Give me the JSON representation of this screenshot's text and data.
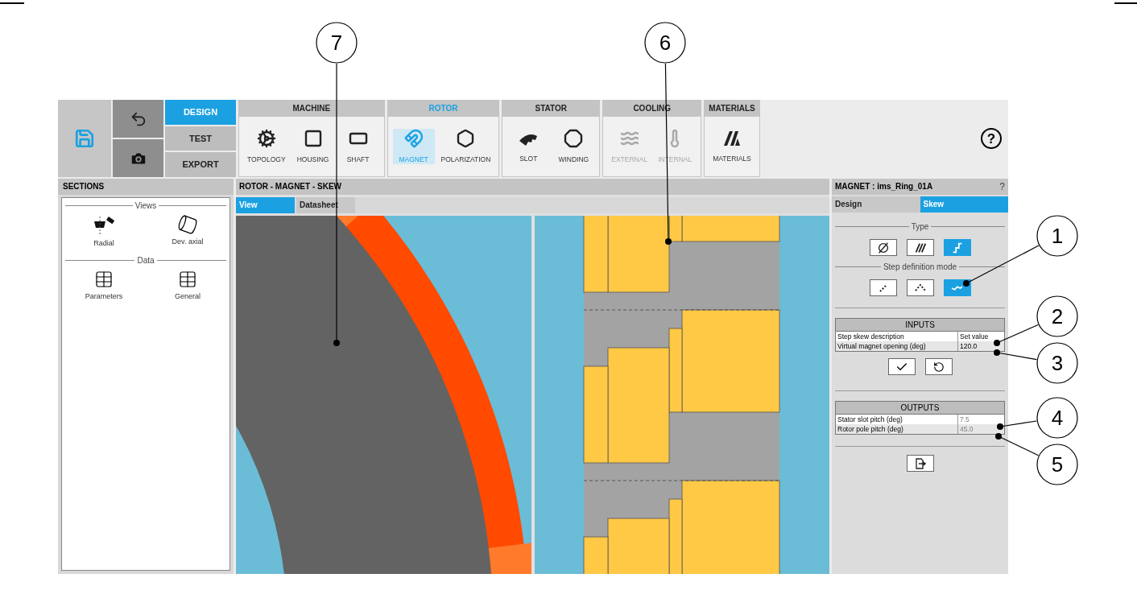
{
  "toolbar": {
    "modes": [
      {
        "label": "DESIGN",
        "selected": true
      },
      {
        "label": "TEST",
        "selected": false
      },
      {
        "label": "EXPORT",
        "selected": false
      }
    ],
    "groups": [
      {
        "title": "MACHINE",
        "selected": false,
        "tools": [
          {
            "label": "TOPOLOGY",
            "selected": false,
            "disabled": false
          },
          {
            "label": "HOUSING",
            "selected": false,
            "disabled": false
          },
          {
            "label": "SHAFT",
            "selected": false,
            "disabled": false
          }
        ]
      },
      {
        "title": "ROTOR",
        "selected": true,
        "tools": [
          {
            "label": "MAGNET",
            "selected": true,
            "disabled": false
          },
          {
            "label": "POLARIZATION",
            "selected": false,
            "disabled": false
          }
        ]
      },
      {
        "title": "STATOR",
        "selected": false,
        "tools": [
          {
            "label": "SLOT",
            "selected": false,
            "disabled": false
          },
          {
            "label": "WINDING",
            "selected": false,
            "disabled": false
          }
        ]
      },
      {
        "title": "COOLING",
        "selected": false,
        "tools": [
          {
            "label": "EXTERNAL",
            "selected": false,
            "disabled": true
          },
          {
            "label": "INTERNAL",
            "selected": false,
            "disabled": true
          }
        ]
      },
      {
        "title": "MATERIALS",
        "selected": false,
        "tools": [
          {
            "label": "MATERIALS",
            "selected": false,
            "disabled": false
          }
        ]
      }
    ]
  },
  "sections": {
    "title": "SECTIONS",
    "groups": [
      {
        "title": "Views",
        "items": [
          {
            "label": "Radial"
          },
          {
            "label": "Dev. axial"
          }
        ]
      },
      {
        "title": "Data",
        "items": [
          {
            "label": "Parameters"
          },
          {
            "label": "General"
          }
        ]
      }
    ]
  },
  "view": {
    "title": "ROTOR - MAGNET - SKEW",
    "tabs": [
      {
        "label": "View",
        "selected": true
      },
      {
        "label": "Datasheet",
        "selected": false
      }
    ]
  },
  "properties": {
    "title": "MAGNET : ims_Ring_01A",
    "help": "?",
    "tabs": [
      {
        "label": "Design",
        "selected": false
      },
      {
        "label": "Skew",
        "selected": true
      }
    ],
    "type": {
      "title": "Type",
      "options": [
        {
          "selected": false
        },
        {
          "selected": false
        },
        {
          "selected": true
        }
      ]
    },
    "step_mode": {
      "title": "Step definition mode",
      "options": [
        {
          "selected": false
        },
        {
          "selected": false
        },
        {
          "selected": true
        }
      ]
    },
    "inputs": {
      "title": "INPUTS",
      "rows": [
        {
          "label": "Step skew description",
          "value": "Set value",
          "disabled": false
        },
        {
          "label": "Virtual magnet opening  (deg)",
          "value": "120.0",
          "disabled": false
        }
      ]
    },
    "outputs": {
      "title": "OUTPUTS",
      "rows": [
        {
          "label": "Stator slot pitch (deg)",
          "value": "7.5",
          "disabled": true
        },
        {
          "label": "Rotor pole pitch (deg)",
          "value": "45.0",
          "disabled": true
        }
      ]
    }
  },
  "callouts": [
    {
      "label": "7"
    },
    {
      "label": "6"
    },
    {
      "label": "1"
    },
    {
      "label": "2"
    },
    {
      "label": "3"
    },
    {
      "label": "4"
    },
    {
      "label": "5"
    }
  ]
}
